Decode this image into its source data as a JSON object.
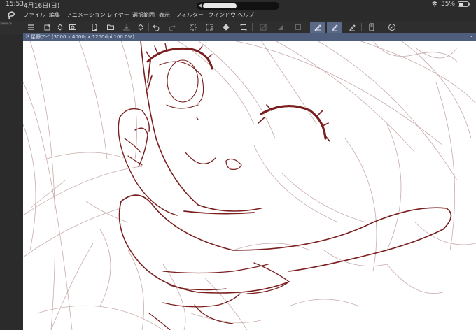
{
  "status_bar": {
    "time": "15:53",
    "date": "4月16日(日)",
    "battery": "35%"
  },
  "menu": {
    "items": [
      "ファイル",
      "編集",
      "アニメーション",
      "レイヤー",
      "選択範囲",
      "表示",
      "フィルター",
      "ウィンドウ",
      "ヘルプ"
    ]
  },
  "toolbar": {
    "icons": [
      "menu-icon",
      "new-layer-icon",
      "up-down-icon",
      "layer-property-icon",
      "new-file-icon",
      "open-folder-icon",
      "save-icon",
      "up-down-icon",
      "undo-icon",
      "redo-icon",
      "loading-icon",
      "clear-icon",
      "fill-icon",
      "transform-icon",
      "ruler-icon",
      "paper-layer-icon",
      "canvas-frame-icon",
      "pen-selected-icon",
      "pen-selected-icon",
      "pen-icon",
      "smartphone-icon",
      "pen-settings-icon"
    ]
  },
  "document": {
    "title": "星野アイ (3000 x 4000px 1200dpi 100.0%)"
  },
  "colors": {
    "lineart": "#7a1e1e",
    "sketch": "#c4a5a5",
    "selected": "#5a6a86"
  }
}
